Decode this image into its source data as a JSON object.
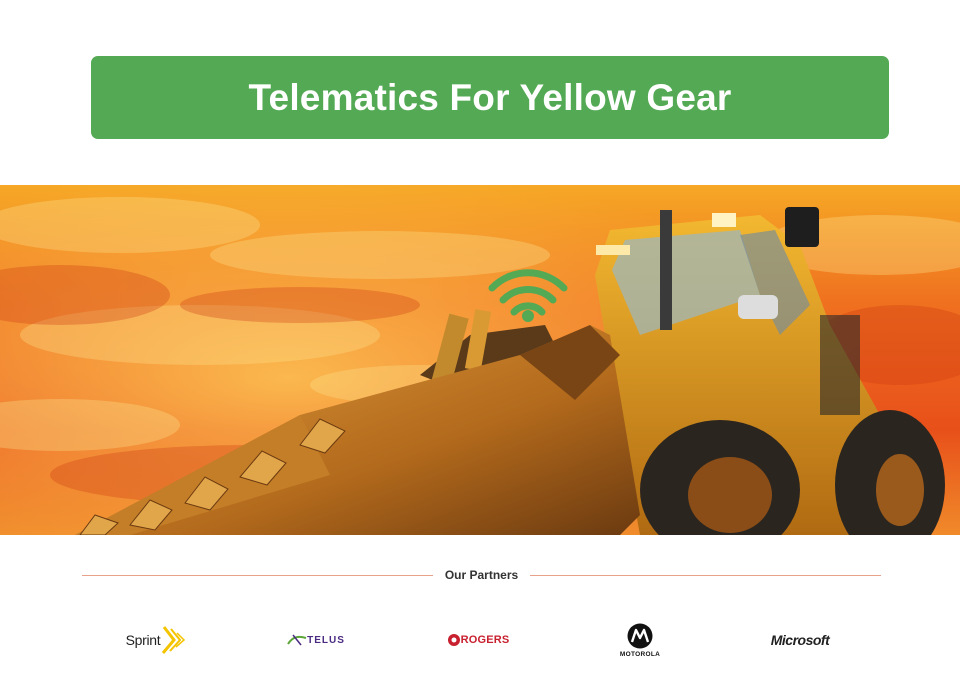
{
  "banner": {
    "title": "Telematics For Yellow Gear",
    "color": "#53a954"
  },
  "hero": {
    "image": "yellow-wheel-loader-sunset-sky",
    "overlay_icon": "wifi-signal-icon",
    "overlay_color": "#53a954"
  },
  "partners": {
    "heading": "Our Partners",
    "rule_color": "#e8a28c",
    "logos": [
      {
        "name": "Sprint",
        "text": "Sprint",
        "icon": "sprint-logo"
      },
      {
        "name": "Telus",
        "text": "TELUS",
        "icon": "telus-logo"
      },
      {
        "name": "Rogers",
        "text": "ROGERS",
        "icon": "rogers-logo"
      },
      {
        "name": "Motorola",
        "text": "MOTOROLA",
        "icon": "motorola-logo"
      },
      {
        "name": "Microsoft",
        "text": "Microsoft",
        "icon": "microsoft-logo"
      }
    ]
  }
}
